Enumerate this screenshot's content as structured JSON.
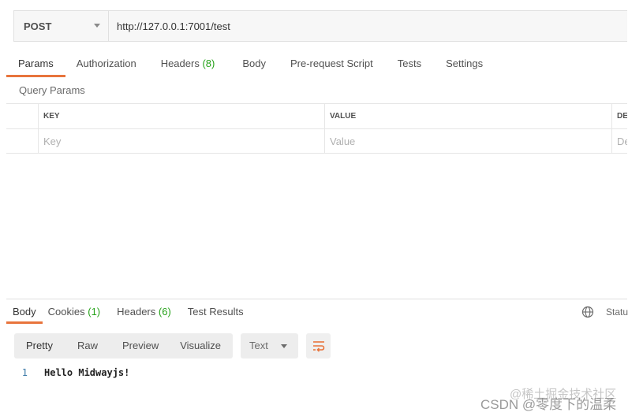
{
  "request": {
    "method": "POST",
    "url": "http://127.0.0.1:7001/test"
  },
  "request_tabs": [
    {
      "label": "Params",
      "count": ""
    },
    {
      "label": "Authorization",
      "count": ""
    },
    {
      "label": "Headers",
      "count": "(8)"
    },
    {
      "label": "Body",
      "count": ""
    },
    {
      "label": "Pre-request Script",
      "count": ""
    },
    {
      "label": "Tests",
      "count": ""
    },
    {
      "label": "Settings",
      "count": ""
    }
  ],
  "query_params": {
    "title": "Query Params",
    "columns": [
      "KEY",
      "VALUE",
      "DE"
    ],
    "placeholders": [
      "Key",
      "Value",
      "De"
    ]
  },
  "response_tabs": [
    {
      "label": "Body",
      "count": ""
    },
    {
      "label": "Cookies",
      "count": "(1)"
    },
    {
      "label": "Headers",
      "count": "(6)"
    },
    {
      "label": "Test Results",
      "count": ""
    }
  ],
  "response_status_label": "Statu",
  "response_views": [
    "Pretty",
    "Raw",
    "Preview",
    "Visualize"
  ],
  "response_format": "Text",
  "response_body": [
    {
      "line": "1",
      "text": "Hello Midwayjs!"
    }
  ],
  "watermarks": [
    "@稀土掘金技术社区",
    "CSDN @零度下的温柔"
  ],
  "colors": {
    "accent": "#e8743c",
    "count_green": "#26a21a",
    "line_number": "#3c7aa8"
  },
  "icons": [
    "chevron-down-icon",
    "globe-icon",
    "wrap-lines-icon"
  ]
}
